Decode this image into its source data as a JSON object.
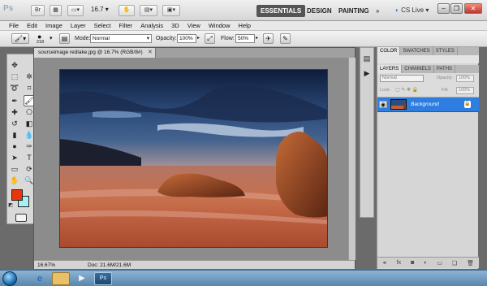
{
  "appbar": {
    "logo": "Ps",
    "zoom": "16.7",
    "workspaces": [
      "ESSENTIALS",
      "DESIGN",
      "PAINTING"
    ],
    "more": "»",
    "cs_live": "CS Live"
  },
  "menu": [
    "File",
    "Edit",
    "Image",
    "Layer",
    "Select",
    "Filter",
    "Analysis",
    "3D",
    "View",
    "Window",
    "Help"
  ],
  "options": {
    "brush_size": "218",
    "mode_label": "Mode:",
    "mode_value": "Normal",
    "opacity_label": "Opacity:",
    "opacity_value": "100%",
    "flow_label": "Flow:",
    "flow_value": "50%"
  },
  "document": {
    "tab_title": "sourceimage redlake.jpg @ 16.7% (RGB/8#)",
    "zoom": "16.67%",
    "doc_info": "Doc: 21.6M/21.6M"
  },
  "colors": {
    "foreground": "#e8350c",
    "background": "#a8f0f3",
    "layer_highlight": "#2e7de1"
  },
  "panels": {
    "color_tabs": [
      "COLOR",
      "SWATCHES",
      "STYLES"
    ],
    "layer_tabs": [
      "LAYERS",
      "CHANNELS",
      "PATHS"
    ],
    "blend_mode": "Normal",
    "opacity_label": "Opacity:",
    "opacity_value": "100%",
    "lock_label": "Lock:",
    "fill_label": "Fill:",
    "fill_value": "100%",
    "layer_name": "Background"
  }
}
